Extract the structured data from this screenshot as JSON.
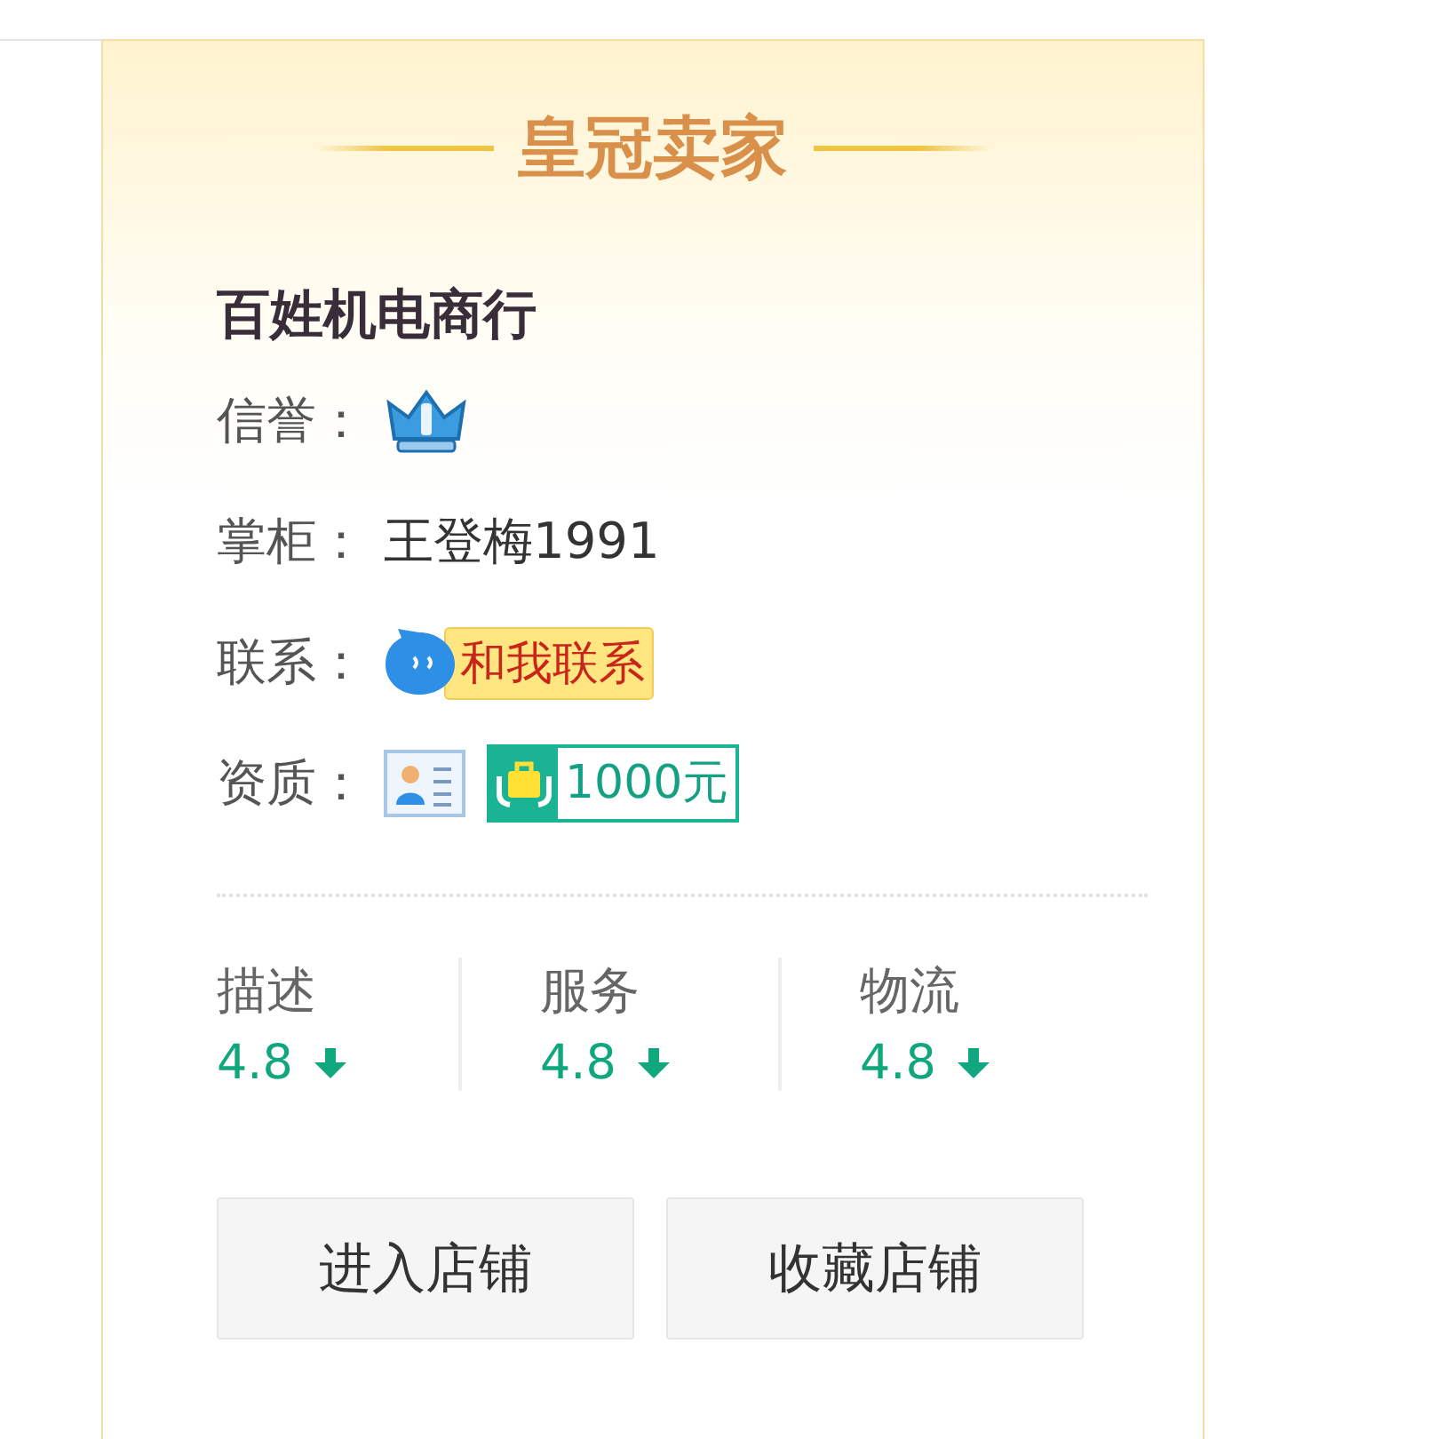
{
  "header": {
    "title": "皇冠卖家"
  },
  "shop": {
    "name": "百姓机电商行"
  },
  "info": [
    {
      "kind": "credit",
      "label": "信誉："
    },
    {
      "kind": "text",
      "label": "掌柜：",
      "value": "王登梅1991"
    },
    {
      "kind": "contact",
      "label": "联系：",
      "button": "和我联系"
    },
    {
      "kind": "badges",
      "label": "资质：",
      "deposit": "1000元"
    }
  ],
  "ratings": [
    {
      "label": "描述",
      "score": "4.8",
      "falling": true
    },
    {
      "label": "服务",
      "score": "4.8",
      "falling": true
    },
    {
      "label": "物流",
      "score": "4.8",
      "falling": true
    }
  ],
  "buttons": [
    "进入店铺",
    "收藏店铺"
  ]
}
